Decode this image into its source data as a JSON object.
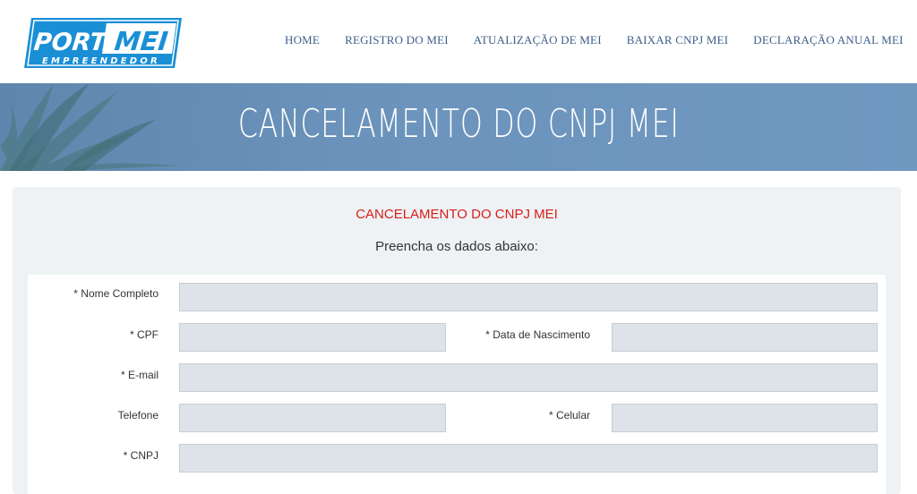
{
  "logo": {
    "word1": "PORTAL",
    "word2": "MEI",
    "tagline": "EMPREENDEDOR"
  },
  "nav": {
    "items": [
      {
        "label": "HOME"
      },
      {
        "label": "REGISTRO DO MEI"
      },
      {
        "label": "ATUALIZAÇÃO DE MEI"
      },
      {
        "label": "BAIXAR CNPJ MEI"
      },
      {
        "label": "DECLARAÇÃO ANUAL MEI"
      }
    ]
  },
  "banner": {
    "title": "CANCELAMENTO DO CNPJ MEI"
  },
  "form": {
    "title": "CANCELAMENTO DO CNPJ MEI",
    "subtitle": "Preencha os dados abaixo:",
    "fields": {
      "nome": {
        "label": "* Nome Completo",
        "value": ""
      },
      "cpf": {
        "label": "* CPF",
        "value": ""
      },
      "nascimento": {
        "label": "* Data de Nascimento",
        "value": ""
      },
      "email": {
        "label": "* E-mail",
        "value": ""
      },
      "telefone": {
        "label": "Telefone",
        "value": ""
      },
      "celular": {
        "label": "* Celular",
        "value": ""
      },
      "cnpj": {
        "label": "* CNPJ",
        "value": ""
      }
    }
  },
  "colors": {
    "nav_text": "#3d5f8a",
    "banner_bg": "#6b93bb",
    "form_title": "#d91e18",
    "input_bg": "#dde3e8",
    "logo_blue": "#1a8fd6"
  }
}
